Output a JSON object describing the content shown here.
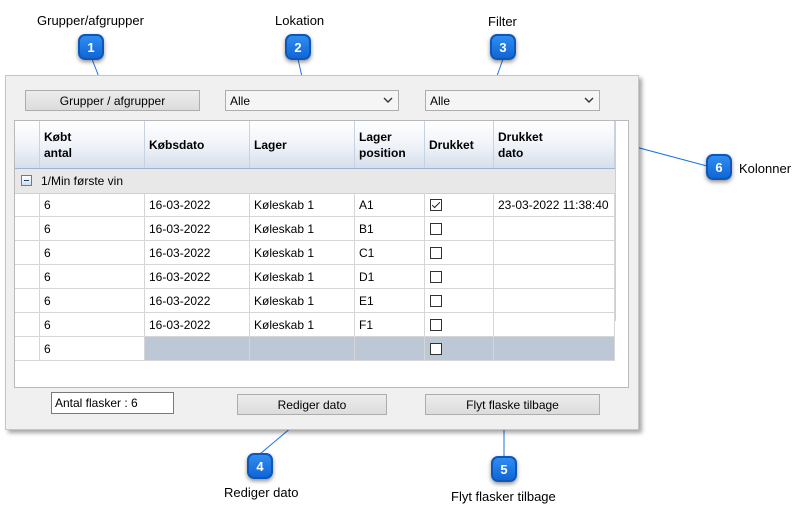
{
  "annotations": [
    {
      "number": "1",
      "caption": "Grupper/afgrupper"
    },
    {
      "number": "2",
      "caption": "Lokation"
    },
    {
      "number": "3",
      "caption": "Filter"
    },
    {
      "number": "4",
      "caption": "Rediger dato"
    },
    {
      "number": "5",
      "caption": "Flyt flasker tilbage"
    },
    {
      "number": "6",
      "caption": "Kolonner"
    }
  ],
  "toolbar": {
    "group_button_label": "Grupper / afgrupper",
    "location_select": {
      "value": "Alle",
      "icon": "chevron-down-icon"
    },
    "filter_select": {
      "value": "Alle",
      "icon": "chevron-down-icon"
    }
  },
  "grid": {
    "columns": [
      {
        "key": "antal",
        "label": "Købt\nantal"
      },
      {
        "key": "koebsdato",
        "label": "Købsdato"
      },
      {
        "key": "lager",
        "label": "Lager"
      },
      {
        "key": "position",
        "label": "Lager\nposition"
      },
      {
        "key": "drukket",
        "label": "Drukket"
      },
      {
        "key": "drukket_dato",
        "label": "Drukket\ndato"
      }
    ],
    "group": {
      "label": "1/Min første vin",
      "icon": "collapse-minus-icon"
    },
    "rows": [
      {
        "antal": "6",
        "koebsdato": "16-03-2022",
        "lager": "Køleskab 1",
        "position": "A1",
        "drukket": true,
        "drukket_dato": "23-03-2022 11:38:40"
      },
      {
        "antal": "6",
        "koebsdato": "16-03-2022",
        "lager": "Køleskab 1",
        "position": "B1",
        "drukket": false,
        "drukket_dato": ""
      },
      {
        "antal": "6",
        "koebsdato": "16-03-2022",
        "lager": "Køleskab 1",
        "position": "C1",
        "drukket": false,
        "drukket_dato": ""
      },
      {
        "antal": "6",
        "koebsdato": "16-03-2022",
        "lager": "Køleskab 1",
        "position": "D1",
        "drukket": false,
        "drukket_dato": ""
      },
      {
        "antal": "6",
        "koebsdato": "16-03-2022",
        "lager": "Køleskab 1",
        "position": "E1",
        "drukket": false,
        "drukket_dato": ""
      },
      {
        "antal": "6",
        "koebsdato": "16-03-2022",
        "lager": "Køleskab 1",
        "position": "F1",
        "drukket": false,
        "drukket_dato": ""
      }
    ],
    "new_row": {
      "antal": "6",
      "drukket": false
    }
  },
  "footer": {
    "count_label": "Antal flasker : 6",
    "edit_date_button": "Rediger dato",
    "move_back_button": "Flyt flaske tilbage"
  },
  "colors": {
    "badge": "#1a73e8",
    "group_row": "#e8e8e8",
    "new_row_shade": "#bcc8d6"
  }
}
